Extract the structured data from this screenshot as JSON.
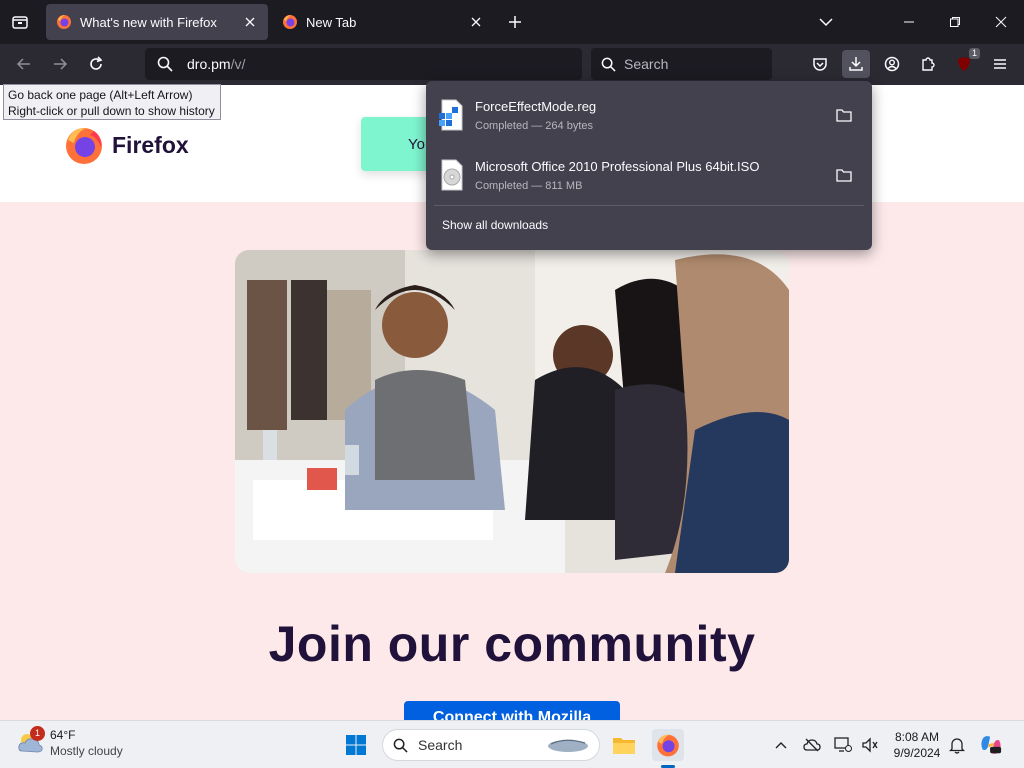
{
  "browser": {
    "tabs": [
      {
        "title": "What's new with Firefox",
        "active": true
      },
      {
        "title": "New Tab",
        "active": false
      }
    ],
    "url": {
      "host": "dro.pm",
      "path": "/v/"
    },
    "search_placeholder": "Search",
    "extension_badge": "1"
  },
  "tooltip": {
    "line1": "Go back one page (Alt+Left Arrow)",
    "line2": "Right-click or pull down to show history"
  },
  "downloads": {
    "items": [
      {
        "name": "ForceEffectMode.reg",
        "status": "Completed — 264 bytes",
        "icon": "registry-file-icon"
      },
      {
        "name": "Microsoft Office 2010 Professional Plus 64bit.ISO",
        "status": "Completed — 811 MB",
        "icon": "disc-image-icon"
      }
    ],
    "show_all": "Show all downloads"
  },
  "page": {
    "brand": "Firefox",
    "teal_button_partial": "Yo",
    "headline": "Join our community",
    "cta": "Connect with Mozilla"
  },
  "taskbar": {
    "weather_temp": "64°F",
    "weather_cond": "Mostly cloudy",
    "weather_badge": "1",
    "search_placeholder": "Search",
    "time": "8:08 AM",
    "date": "9/9/2024"
  },
  "colors": {
    "accent": "#0060df",
    "page_bg": "#fde9ea",
    "headline": "#20123a",
    "teal": "#7ff5cf"
  }
}
